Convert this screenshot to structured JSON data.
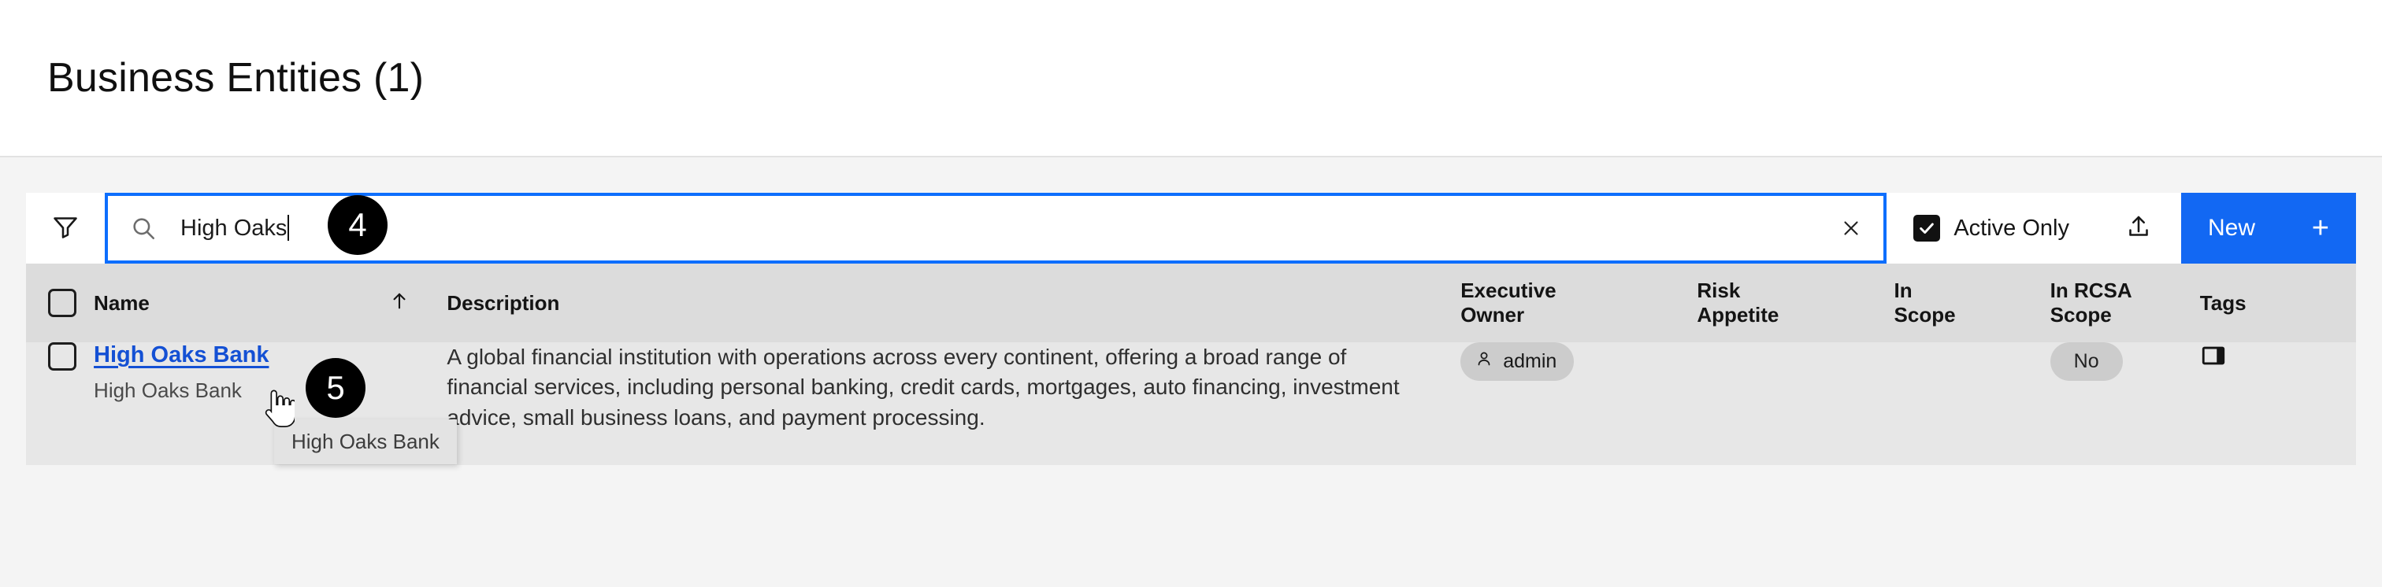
{
  "header": {
    "title": "Business Entities (1)"
  },
  "toolbar": {
    "filter_icon": "filter-funnel-icon",
    "search_icon": "search-icon",
    "search_value": "High Oaks",
    "clear_icon": "close-x-icon",
    "active_only_label": "Active Only",
    "active_only_checked": true,
    "export_icon": "upload-export-icon",
    "new_label": "New",
    "new_plus": "+",
    "accent_color": "#1268f3"
  },
  "table": {
    "columns": [
      {
        "key": "select",
        "label": ""
      },
      {
        "key": "name",
        "label": "Name",
        "sort": "ascending",
        "sort_icon": "arrow-up-icon"
      },
      {
        "key": "desc",
        "label": "Description"
      },
      {
        "key": "exec",
        "label_line1": "Executive",
        "label_line2": "Owner"
      },
      {
        "key": "risk",
        "label_line1": "Risk",
        "label_line2": "Appetite"
      },
      {
        "key": "scope",
        "label_line1": "In",
        "label_line2": "Scope"
      },
      {
        "key": "rcsa",
        "label_line1": "In RCSA",
        "label_line2": "Scope"
      },
      {
        "key": "tags",
        "label": "Tags"
      }
    ],
    "rows": [
      {
        "name": "High Oaks Bank",
        "subtitle": "High Oaks Bank",
        "description": "A global financial institution with operations across every continent, offering a broad range of financial services, including personal banking, credit cards, mortgages, auto financing, investment advice, small business loans, and payment processing.",
        "executive_owner": "admin",
        "executive_owner_icon": "person-icon",
        "risk_appetite": "",
        "in_scope": "",
        "in_rcsa_scope": "No",
        "tags": "",
        "row_action_icon": "side-panel-toggle-icon"
      }
    ]
  },
  "annotations": {
    "badges": [
      {
        "id": "badge4",
        "label": "4"
      },
      {
        "id": "badge5",
        "label": "5"
      }
    ],
    "tooltip_text": "High Oaks Bank",
    "cursor": "pointer-hand-cursor"
  }
}
